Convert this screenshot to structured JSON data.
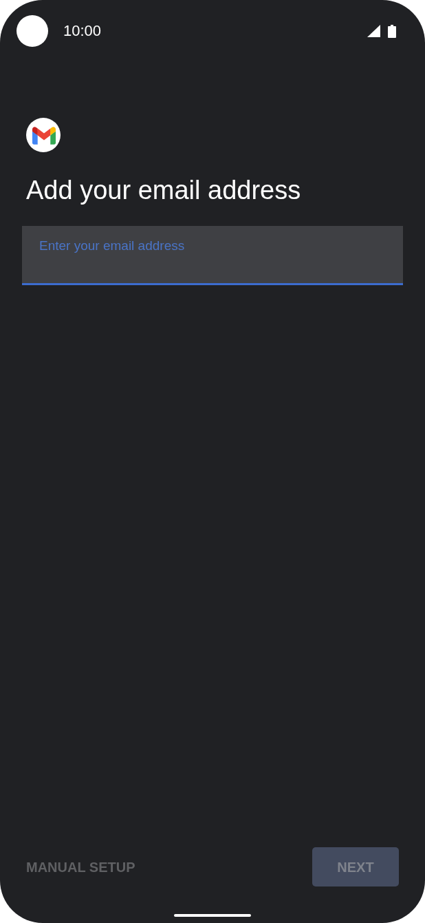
{
  "status_bar": {
    "time": "10:00"
  },
  "title": "Add your email address",
  "email_field": {
    "placeholder": "Enter your email address",
    "focused": true
  },
  "buttons": [
    {
      "label": "MANUAL SETUP",
      "kind": "text",
      "disabled": true
    },
    {
      "label": "NEXT",
      "kind": "filled",
      "disabled": true
    }
  ]
}
